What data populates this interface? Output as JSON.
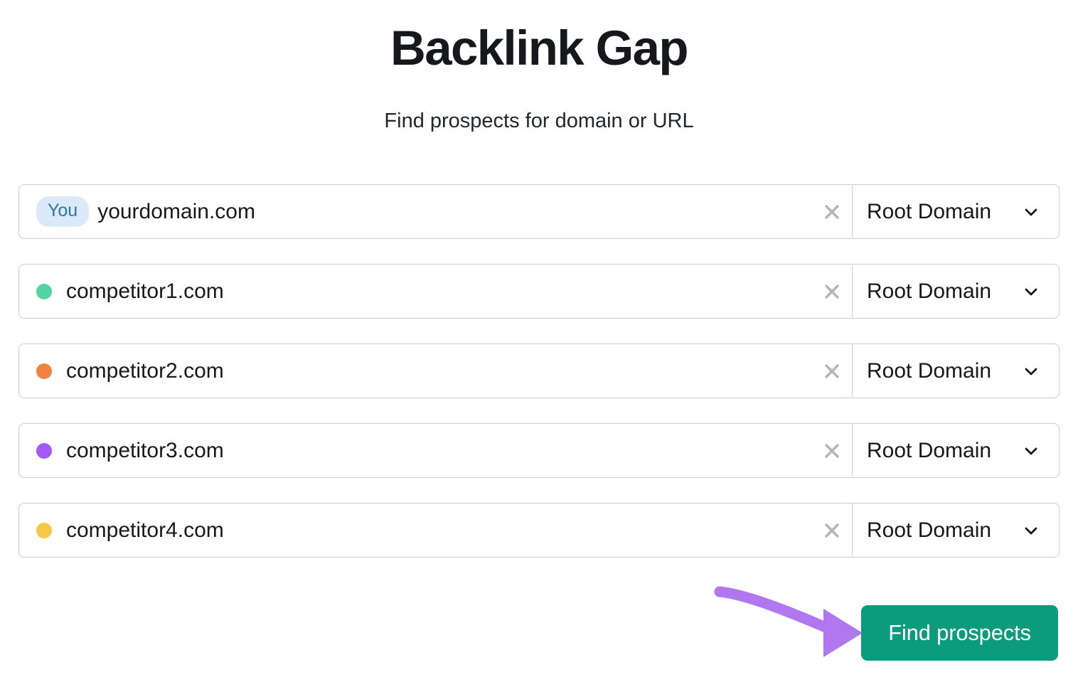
{
  "header": {
    "title": "Backlink Gap",
    "subtitle": "Find prospects for domain or URL"
  },
  "rows": [
    {
      "badge_label": "You",
      "marker_type": "badge",
      "marker_color": "#dbeaf8",
      "domain": "yourdomain.com",
      "clear_icon": "close-icon",
      "scope_label": "Root Domain",
      "chevron_icon": "chevron-down-icon"
    },
    {
      "badge_label": "",
      "marker_type": "dot",
      "marker_color": "#4fd6a2",
      "domain": "competitor1.com",
      "clear_icon": "close-icon",
      "scope_label": "Root Domain",
      "chevron_icon": "chevron-down-icon"
    },
    {
      "badge_label": "",
      "marker_type": "dot",
      "marker_color": "#f2823f",
      "domain": "competitor2.com",
      "clear_icon": "close-icon",
      "scope_label": "Root Domain",
      "chevron_icon": "chevron-down-icon"
    },
    {
      "badge_label": "",
      "marker_type": "dot",
      "marker_color": "#a259f7",
      "domain": "competitor3.com",
      "clear_icon": "close-icon",
      "scope_label": "Root Domain",
      "chevron_icon": "chevron-down-icon"
    },
    {
      "badge_label": "",
      "marker_type": "dot",
      "marker_color": "#f6c846",
      "domain": "competitor4.com",
      "clear_icon": "close-icon",
      "scope_label": "Root Domain",
      "chevron_icon": "chevron-down-icon"
    }
  ],
  "cta": {
    "label": "Find prospects",
    "color": "#0b9b7d"
  },
  "annotation": {
    "arrow_icon": "curved-arrow-right-icon",
    "color": "#b077f0"
  },
  "colors": {
    "text": "#17181c",
    "border": "#c9ccd1",
    "clear_icon": "#b0b4bb",
    "badge_bg": "#dbeaf8",
    "badge_text": "#3073ab"
  }
}
